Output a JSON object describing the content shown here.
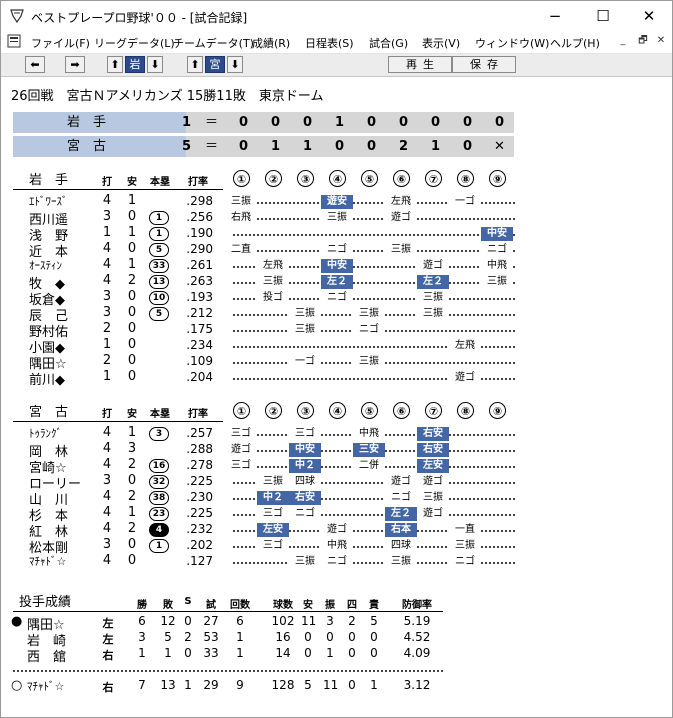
{
  "window": {
    "title": "ベストプレープロ野球'００ - [試合記録]",
    "controls": {
      "minimize": "−",
      "maximize": "☐",
      "close": "✕"
    }
  },
  "menu": {
    "items": [
      "ファイル(F)",
      "リーグデータ(L)",
      "チームデータ(T)",
      "成績(R)",
      "日程表(S)",
      "試合(G)",
      "表示(V)",
      "ウィンドウ(W)",
      "ヘルプ(H)"
    ],
    "mdi": {
      "minimize": "_",
      "restore": "🗗",
      "close": "✕"
    }
  },
  "toolbar": {
    "prev": "⬅",
    "next": "➡",
    "up1": "⬆",
    "team1": "岩",
    "down1": "⬇",
    "up2": "⬆",
    "team2": "宮",
    "down2": "⬇",
    "play": "再生",
    "save": "保存"
  },
  "game": {
    "header": "26回戦　宮古Ｎアメリカンズ 15勝11敗　東京ドーム",
    "scoreboard": [
      {
        "team": "岩　手",
        "runs": "1",
        "eq": "＝",
        "innings": [
          "0",
          "0",
          "0",
          "1",
          "0",
          "0",
          "0",
          "0",
          "0"
        ]
      },
      {
        "team": "宮　古",
        "runs": "5",
        "eq": "＝",
        "innings": [
          "0",
          "1",
          "1",
          "0",
          "0",
          "2",
          "1",
          "0",
          "✕"
        ]
      }
    ]
  },
  "batting_columns": {
    "ab": "打",
    "h": "安",
    "hr": "本塁",
    "avg": "打率"
  },
  "inning_labels": [
    "①",
    "②",
    "③",
    "④",
    "⑤",
    "⑥",
    "⑦",
    "⑧",
    "⑨"
  ],
  "teams": [
    {
      "name": "岩　手",
      "players": [
        {
          "name": "ｴﾄﾞﾜｰｽﾞ",
          "ab": "4",
          "h": "1",
          "hr": "",
          "avg": ".298",
          "results": [
            "三振",
            "",
            "",
            "遊安",
            "",
            "左飛",
            "",
            "一ゴ",
            ""
          ],
          "hit": [
            3
          ]
        },
        {
          "name": "西川遥",
          "ab": "3",
          "h": "0",
          "hr": "1",
          "avg": ".256",
          "results": [
            "右飛",
            "",
            "",
            "三振",
            "",
            "遊ゴ",
            "",
            "",
            ""
          ],
          "hit": []
        },
        {
          "name": "浅　野",
          "ab": "1",
          "h": "1",
          "hr": "1",
          "avg": ".190",
          "results": [
            "",
            "",
            "",
            "",
            "",
            "",
            "",
            "",
            "中安"
          ],
          "hit": [
            8
          ]
        },
        {
          "name": "近　本",
          "ab": "4",
          "h": "0",
          "hr": "5",
          "avg": ".290",
          "results": [
            "二直",
            "",
            "",
            "ニゴ",
            "",
            "三振",
            "",
            "",
            "ニゴ"
          ],
          "hit": []
        },
        {
          "name": "ｵｰｽﾃｨﾝ",
          "ab": "4",
          "h": "1",
          "hr": "33",
          "avg": ".261",
          "results": [
            "",
            "左飛",
            "",
            "中安",
            "",
            "",
            "遊ゴ",
            "",
            "中飛"
          ],
          "hit": [
            3
          ]
        },
        {
          "name": "牧　◆",
          "ab": "4",
          "h": "2",
          "hr": "13",
          "avg": ".263",
          "results": [
            "",
            "三振",
            "",
            "左２",
            "",
            "",
            "左２",
            "",
            "三振"
          ],
          "hit": [
            3,
            6
          ]
        },
        {
          "name": "坂倉◆",
          "ab": "3",
          "h": "0",
          "hr": "10",
          "avg": ".193",
          "results": [
            "",
            "投ゴ",
            "",
            "ニゴ",
            "",
            "",
            "三振",
            "",
            ""
          ],
          "hit": []
        },
        {
          "name": "辰　己",
          "ab": "3",
          "h": "0",
          "hr": "5",
          "avg": ".212",
          "results": [
            "",
            "",
            "三振",
            "",
            "三振",
            "",
            "三振",
            "",
            ""
          ],
          "hit": []
        },
        {
          "name": "野村佑",
          "ab": "2",
          "h": "0",
          "hr": "",
          "avg": ".175",
          "results": [
            "",
            "",
            "三振",
            "",
            "ニゴ",
            "",
            "",
            "",
            ""
          ],
          "hit": []
        },
        {
          "name": "小園◆",
          "ab": "1",
          "h": "0",
          "hr": "",
          "avg": ".234",
          "results": [
            "",
            "",
            "",
            "",
            "",
            "",
            "",
            "左飛",
            ""
          ],
          "hit": []
        },
        {
          "name": "隅田☆",
          "ab": "2",
          "h": "0",
          "hr": "",
          "avg": ".109",
          "results": [
            "",
            "",
            "一ゴ",
            "",
            "三振",
            "",
            "",
            "",
            ""
          ],
          "hit": []
        },
        {
          "name": "前川◆",
          "ab": "1",
          "h": "0",
          "hr": "",
          "avg": ".204",
          "results": [
            "",
            "",
            "",
            "",
            "",
            "",
            "",
            "遊ゴ",
            ""
          ],
          "hit": []
        }
      ]
    },
    {
      "name": "宮　古",
      "players": [
        {
          "name": "ﾄｩﾗﾝｸﾞ",
          "ab": "4",
          "h": "1",
          "hr": "3",
          "avg": ".257",
          "results": [
            "三ゴ",
            "",
            "三ゴ",
            "",
            "中飛",
            "",
            "右安",
            "",
            ""
          ],
          "hit": [
            6
          ]
        },
        {
          "name": "岡　林",
          "ab": "4",
          "h": "3",
          "hr": "",
          "avg": ".288",
          "results": [
            "遊ゴ",
            "",
            "中安",
            "",
            "三安",
            "",
            "右安",
            "",
            ""
          ],
          "hit": [
            2,
            4,
            6
          ]
        },
        {
          "name": "宮崎☆",
          "ab": "4",
          "h": "2",
          "hr": "16",
          "avg": ".278",
          "results": [
            "三ゴ",
            "",
            "中２",
            "",
            "二併",
            "",
            "左安",
            "",
            ""
          ],
          "hit": [
            2,
            6
          ]
        },
        {
          "name": "ローリー",
          "ab": "3",
          "h": "0",
          "hr": "32",
          "avg": ".225",
          "results": [
            "",
            "三振",
            "四球",
            "",
            "",
            "遊ゴ",
            "遊ゴ",
            "",
            ""
          ],
          "hit": []
        },
        {
          "name": "山　川",
          "ab": "4",
          "h": "2",
          "hr": "38",
          "avg": ".230",
          "results": [
            "",
            "中２",
            "右安",
            "",
            "",
            "ニゴ",
            "三振",
            "",
            ""
          ],
          "hit": [
            1,
            2
          ]
        },
        {
          "name": "杉　本",
          "ab": "4",
          "h": "1",
          "hr": "23",
          "avg": ".225",
          "results": [
            "",
            "三ゴ",
            "ニゴ",
            "",
            "",
            "左２",
            "遊ゴ",
            "",
            ""
          ],
          "hit": [
            5
          ]
        },
        {
          "name": "紅　林",
          "ab": "4",
          "h": "2",
          "hr": "4",
          "avg": ".232",
          "results": [
            "",
            "左安",
            "",
            "遊ゴ",
            "",
            "右本",
            "",
            "一直",
            ""
          ],
          "hit": [
            1,
            5
          ],
          "hr_dark": true
        },
        {
          "name": "松本剛",
          "ab": "3",
          "h": "0",
          "hr": "1",
          "avg": ".202",
          "results": [
            "",
            "三ゴ",
            "",
            "中飛",
            "",
            "四球",
            "",
            "三振",
            ""
          ],
          "hit": []
        },
        {
          "name": "ﾏﾁｬﾄﾞ☆",
          "ab": "4",
          "h": "0",
          "hr": "",
          "avg": ".127",
          "results": [
            "",
            "",
            "三振",
            "ニゴ",
            "",
            "三振",
            "",
            "ニゴ",
            ""
          ],
          "hit": []
        }
      ]
    }
  ],
  "pitching": {
    "title": "投手成績",
    "columns": [
      "勝",
      "敗",
      "S",
      "試",
      "回数",
      "球数",
      "安",
      "振",
      "四",
      "責",
      "防御率"
    ],
    "pitchers": [
      {
        "mark": "●",
        "name": "隅田☆",
        "hand": "左",
        "w": "6",
        "l": "12",
        "s": "0",
        "g": "27",
        "ip": "6",
        "pitches": "102",
        "h": "11",
        "so": "3",
        "bb": "2",
        "er": "5",
        "era": "5.19"
      },
      {
        "mark": "",
        "name": "岩　崎",
        "hand": "左",
        "w": "3",
        "l": "5",
        "s": "2",
        "g": "53",
        "ip": "1",
        "pitches": "16",
        "h": "0",
        "so": "0",
        "bb": "0",
        "er": "0",
        "era": "4.52"
      },
      {
        "mark": "",
        "name": "西　舘",
        "hand": "右",
        "w": "1",
        "l": "1",
        "s": "0",
        "g": "33",
        "ip": "1",
        "pitches": "14",
        "h": "0",
        "so": "1",
        "bb": "0",
        "er": "0",
        "era": "4.09"
      },
      {
        "mark": "○",
        "name": "ﾏﾁｬﾄﾞ☆",
        "hand": "右",
        "w": "7",
        "l": "13",
        "s": "1",
        "g": "29",
        "ip": "9",
        "pitches": "128",
        "h": "5",
        "so": "11",
        "bb": "0",
        "er": "1",
        "era": "3.12"
      }
    ]
  },
  "colors": {
    "hit_bg": "#4466a4",
    "scoreboard_name": "#b7c8e0",
    "scoreboard_band": "#d6d6d6",
    "selected_team": "#2b4b8a"
  }
}
